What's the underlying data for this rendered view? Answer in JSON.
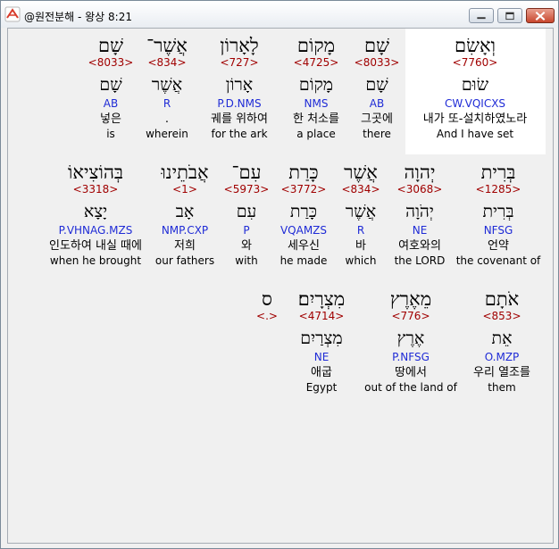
{
  "window": {
    "title": "@원전분해 - 왕상 8:21"
  },
  "rows": [
    [
      {
        "heb": "וְאָשִׂם",
        "strong": "<7760>",
        "heb_base": "שׂוּם",
        "morph": "CW.VQICXS",
        "kor": "내가 또-설치하였노라",
        "eng": "And I have set"
      },
      {
        "heb": "שָׁם",
        "strong": "<8033>",
        "heb_base": "שָׁם",
        "morph": "AB",
        "kor": "그곳에",
        "eng": "there"
      },
      {
        "heb": "מָקוֹם",
        "strong": "<4725>",
        "heb_base": "מָקוֹם",
        "morph": "NMS",
        "kor": "한 처소를",
        "eng": "a place"
      },
      {
        "heb": "לָאָרוֹן",
        "strong": "<727>",
        "heb_base": "אָרוֹן",
        "morph": "P.D.NMS",
        "kor": "궤를 위하여",
        "eng": "for the ark"
      },
      {
        "heb": "אֲשֶׁר־",
        "strong": "<834>",
        "heb_base": "אֲשֶׁר",
        "morph": "R",
        "kor": ".",
        "eng": "wherein"
      },
      {
        "heb": "שָׁם",
        "strong": "<8033>",
        "heb_base": "שָׁם",
        "morph": "AB",
        "kor": "넣은",
        "eng": "is"
      }
    ],
    [
      {
        "heb": "בְּרִית",
        "strong": "<1285>",
        "heb_base": "בְּרִית",
        "morph": "NFSG",
        "kor": "언약",
        "eng": "the covenant of"
      },
      {
        "heb": "יְהוָה",
        "strong": "<3068>",
        "heb_base": "יְהֹוָה",
        "morph": "NE",
        "kor": "여호와의",
        "eng": "the LORD"
      },
      {
        "heb": "אֲשֶׁר",
        "strong": "<834>",
        "heb_base": "אֲשֶׁר",
        "morph": "R",
        "kor": "바",
        "eng": "which"
      },
      {
        "heb": "כָּרַת",
        "strong": "<3772>",
        "heb_base": "כָּרַת",
        "morph": "VQAMZS",
        "kor": "세우신",
        "eng": "he made"
      },
      {
        "heb": "עִם־",
        "strong": "<5973>",
        "heb_base": "עִם",
        "morph": "P",
        "kor": "와",
        "eng": "with"
      },
      {
        "heb": "אֲבֹתֵינוּ",
        "strong": "<1>",
        "heb_base": "אָב",
        "morph": "NMP.CXP",
        "kor": "저희",
        "eng": "our fathers"
      },
      {
        "heb": "בְּהוֹצִיאוֹ",
        "strong": "<3318>",
        "heb_base": "יָצָא",
        "morph": "P.VHNAG.MZS",
        "kor": "인도하여 내실 때에",
        "eng": "when he brought"
      }
    ],
    [
      {
        "heb": "אֹתָם",
        "strong": "<853>",
        "heb_base": "אֵת",
        "morph": "O.MZP",
        "kor": "우리 열조를",
        "eng": "them"
      },
      {
        "heb": "מֵאֶרֶץ",
        "strong": "<776>",
        "heb_base": "אֶרֶץ",
        "morph": "P.NFSG",
        "kor": "땅에서",
        "eng": "out of the land of"
      },
      {
        "heb": "מִצְרָיִם׃",
        "strong": "<4714>",
        "heb_base": "מִצְרַיִם",
        "morph": "NE",
        "kor": "애굽",
        "eng": "Egypt"
      },
      {
        "heb": "ס",
        "strong": "<.>",
        "heb_base": "",
        "morph": "",
        "kor": "",
        "eng": ""
      }
    ]
  ]
}
